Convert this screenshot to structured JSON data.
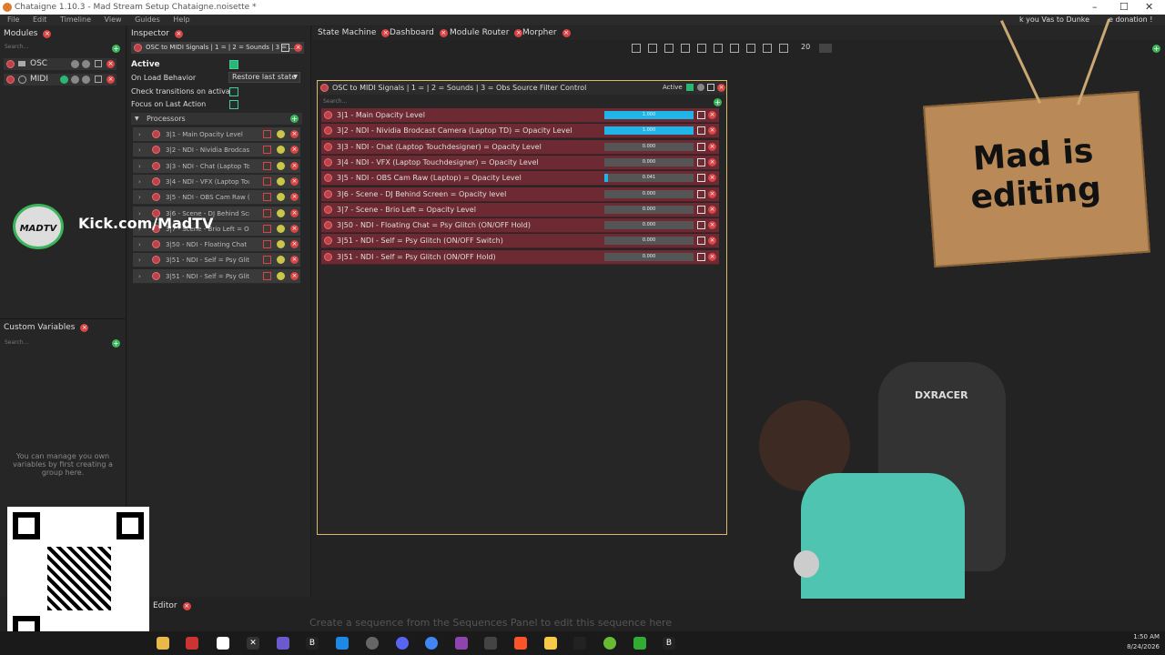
{
  "window": {
    "title": "Chataigne 1.10.3 - Mad Stream Setup Chataigne.noisette *",
    "controls": [
      "–",
      "☐",
      "✕"
    ]
  },
  "menu": [
    "File",
    "Edit",
    "Timeline",
    "View",
    "Guides",
    "Help"
  ],
  "modules": {
    "title": "Modules",
    "search_placeholder": "Search...",
    "items": [
      {
        "label": "OSC"
      },
      {
        "label": "MIDI"
      }
    ]
  },
  "custom_variables": {
    "title": "Custom Variables",
    "search_placeholder": "Search...",
    "empty_text": "You can manage you own variables by first creating a group here."
  },
  "inspector": {
    "title": "Inspector",
    "header": "OSC to MIDI Signals | 1 = | 2 = Sounds | 3 = ...",
    "active_label": "Active",
    "on_load_label": "On Load Behavior",
    "on_load_value": "Restore last state",
    "check_transitions_label": "Check transitions on activate",
    "focus_label": "Focus on Last Action",
    "processors_label": "Processors",
    "processors": [
      "3|1 - Main Opacity Level",
      "3|2 - NDI - Nividia Brodcast ...",
      "3|3 - NDI - Chat (Laptop Tou...",
      "3|4 - NDI - VFX (Laptop Tou...",
      "3|5 - NDI - OBS Cam Raw (L...",
      "3|6 - Scene - DJ Behind Scre...",
      "3|7 - Scene - Brio Left = Op...",
      "3|50 - NDI - Floating Chat = ...",
      "3|51 - NDI - Self = Psy Glitc...",
      "3|51 - NDI - Self = Psy Glitc..."
    ]
  },
  "tabs": [
    "State Machine",
    "Dashboard",
    "Module Router",
    "Morpher"
  ],
  "toolbar": {
    "zoom_value": "20"
  },
  "state_node": {
    "title": "OSC to MIDI Signals | 1 =  | 2 = Sounds | 3 = Obs Source Filter Control",
    "active_label": "Active",
    "search_placeholder": "Search...",
    "rows": [
      {
        "label": "3|1 - Main Opacity Level",
        "value": "1.000",
        "level": 1.0
      },
      {
        "label": "3|2 - NDI - Nividia Brodcast Camera (Laptop TD) = Opacity Level",
        "value": "1.000",
        "level": 1.0
      },
      {
        "label": "3|3 - NDI - Chat (Laptop Touchdesigner) = Opacity Level",
        "value": "0.000",
        "level": 0.0
      },
      {
        "label": "3|4 - NDI - VFX (Laptop Touchdesigner) = Opacity Level",
        "value": "0.000",
        "level": 0.0
      },
      {
        "label": "3|5 - NDI - OBS Cam Raw (Laptop) = Opacity Level",
        "value": "0.041",
        "level": 0.041
      },
      {
        "label": "3|6 - Scene - DJ Behind Screen = Opacity level",
        "value": "0.000",
        "level": 0.0
      },
      {
        "label": "3|7 - Scene - Brio Left = Opacity Level",
        "value": "0.000",
        "level": 0.0
      },
      {
        "label": "3|50 - NDI - Floating Chat = Psy Glitch (ON/OFF Hold)",
        "value": "0.000",
        "level": 0.0
      },
      {
        "label": "3|51 - NDI - Self = Psy Glitch (ON/OFF Switch)",
        "value": "0.000",
        "level": 0.0
      },
      {
        "label": "3|51 - NDI - Self = Psy Glitch (ON/OFF Hold)",
        "value": "0.000",
        "level": 0.0
      }
    ]
  },
  "overlay": {
    "brand_text": "Kick.com/MadTV",
    "logo_text": "MADTV",
    "sign_text": "Mad is editing",
    "ticker_text": "k you Vas to Dunke",
    "ticker_text2": "e donation !",
    "chair_text": "DXRACER"
  },
  "bottom": {
    "editor_tab": "Editor",
    "sequence_hint": "Create a sequence from the Sequences Panel to edit this sequence here"
  },
  "clock": {
    "time": "1:50 AM",
    "date": "8/24/2026"
  }
}
